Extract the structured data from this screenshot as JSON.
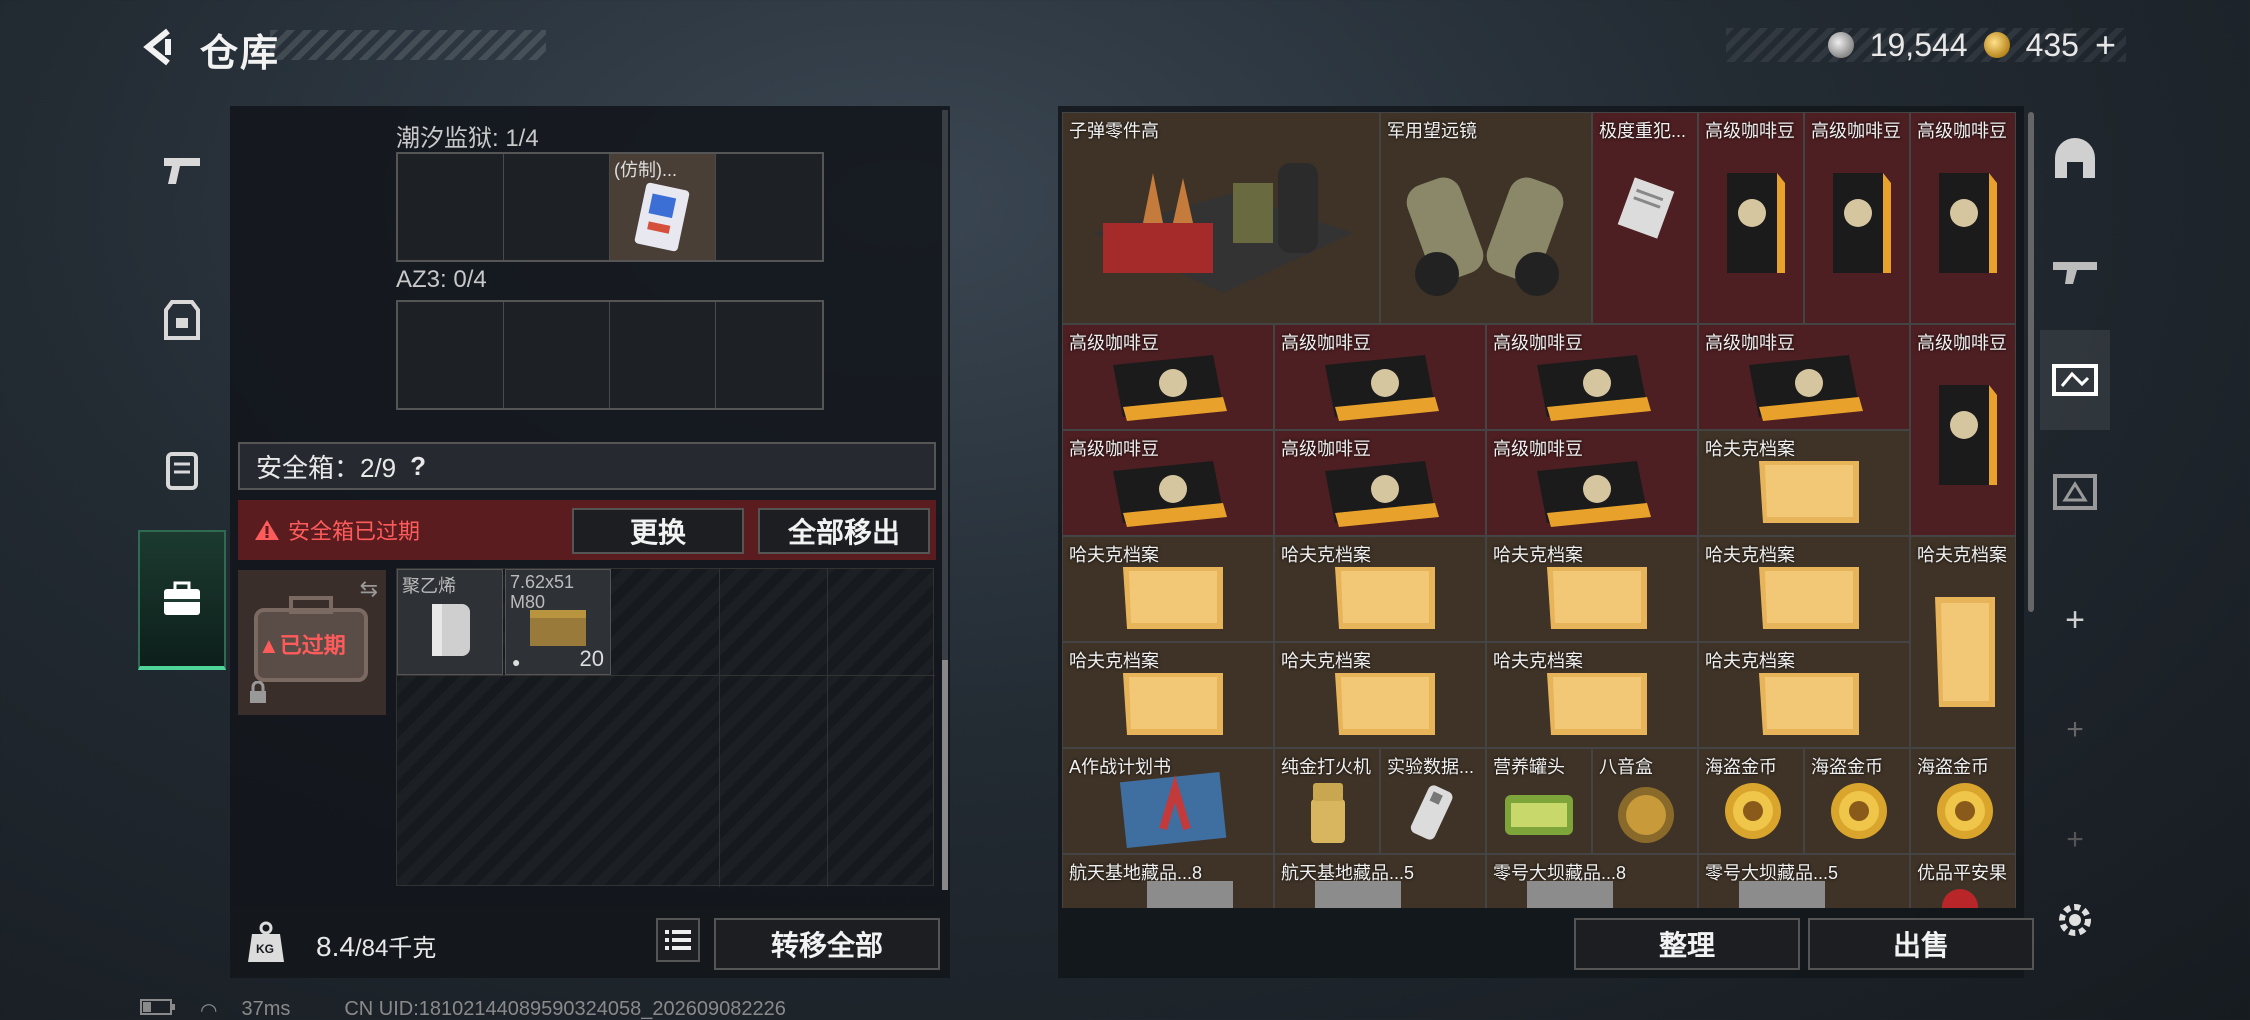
{
  "header": {
    "title": "仓库"
  },
  "currency": {
    "silver_amount": "19,544",
    "gold_amount": "435",
    "gold_plus": "+"
  },
  "left_nav": {
    "items": [
      {
        "name": "weapon-tab",
        "icon": "pistol-icon"
      },
      {
        "name": "armor-tab",
        "icon": "vest-icon"
      },
      {
        "name": "backpack-tab",
        "icon": "backpack-icon"
      },
      {
        "name": "safebox-tab",
        "icon": "briefcase-icon"
      }
    ]
  },
  "containers": {
    "first": {
      "label": "潮汐监狱: 1/4",
      "item_name": "(仿制)..."
    },
    "second": {
      "label": "AZ3: 0/4"
    }
  },
  "safebox": {
    "title": "安全箱：2/9",
    "help": "?",
    "warning": "安全箱已过期",
    "replace_button": "更换",
    "move_all_out_button": "全部移出",
    "expired_badge": "已过期",
    "items": [
      {
        "name": "聚乙烯"
      },
      {
        "name": "7.62x51 M80",
        "count": "20"
      }
    ]
  },
  "weight": {
    "current": "8.4",
    "max": "/84千克",
    "unit_icon": "KG"
  },
  "transfer_all_button": "转移全部",
  "stash": {
    "items": [
      {
        "label": "子弹零件高",
        "row": 0,
        "col": 0,
        "w": 1,
        "h": 1
      },
      {
        "label": "军用望远镜",
        "row": 0,
        "col": 1,
        "w": 1,
        "h": 1
      },
      {
        "label": "极度重犯...",
        "row": 0,
        "col": 2
      },
      {
        "label": "高级咖啡豆",
        "row": 0,
        "col": 3
      },
      {
        "label": "高级咖啡豆",
        "row": 0,
        "col": 4
      },
      {
        "label": "高级咖啡豆",
        "row": 0,
        "col": 5
      },
      {
        "label": "高级咖啡豆",
        "row": 1,
        "col": 0
      },
      {
        "label": "高级咖啡豆",
        "row": 1,
        "col": 1
      },
      {
        "label": "高级咖啡豆",
        "row": 1,
        "col": 2
      },
      {
        "label": "高级咖啡豆",
        "row": 1,
        "col": 3
      },
      {
        "label": "高级咖啡豆",
        "row": 1,
        "col": 4
      },
      {
        "label": "高级咖啡豆",
        "row": 2,
        "col": 0
      },
      {
        "label": "高级咖啡豆",
        "row": 2,
        "col": 1
      },
      {
        "label": "高级咖啡豆",
        "row": 2,
        "col": 2
      },
      {
        "label": "哈夫克档案",
        "row": 2,
        "col": 3
      },
      {
        "label": "哈夫克档案",
        "row": 3,
        "col": 0
      },
      {
        "label": "哈夫克档案",
        "row": 3,
        "col": 1
      },
      {
        "label": "哈夫克档案",
        "row": 3,
        "col": 2
      },
      {
        "label": "哈夫克档案",
        "row": 3,
        "col": 3
      },
      {
        "label": "哈夫克档案",
        "row": 3,
        "col": 4
      },
      {
        "label": "哈夫克档案",
        "row": 4,
        "col": 0
      },
      {
        "label": "哈夫克档案",
        "row": 4,
        "col": 1
      },
      {
        "label": "哈夫克档案",
        "row": 4,
        "col": 2
      },
      {
        "label": "哈夫克档案",
        "row": 4,
        "col": 3
      },
      {
        "label": "A作战计划书",
        "row": 5,
        "col": 0
      },
      {
        "label": "纯金打火机",
        "row": 5,
        "col": 1
      },
      {
        "label": "实验数据...",
        "row": 5,
        "col": 2
      },
      {
        "label": "营养罐头",
        "row": 5,
        "col": 3
      },
      {
        "label": "八音盒",
        "row": 5,
        "col": 4
      },
      {
        "label": "海盗金币",
        "row": 5,
        "col": 5
      },
      {
        "label": "海盗金币",
        "row": 5,
        "col": 6
      },
      {
        "label": "海盗金币",
        "row": 5,
        "col": 7
      },
      {
        "label": "航天基地藏品...8",
        "row": 6,
        "col": 0
      },
      {
        "label": "航天基地藏品...5",
        "row": 6,
        "col": 1
      },
      {
        "label": "零号大坝藏品...8",
        "row": 6,
        "col": 2
      },
      {
        "label": "零号大坝藏品...5",
        "row": 6,
        "col": 3
      },
      {
        "label": "优品平安果",
        "row": 6,
        "col": 4
      }
    ]
  },
  "actions": {
    "organize_button": "整理",
    "sell_button": "出售"
  },
  "status": {
    "ping": "37ms",
    "uid": "CN UID:18102144089590324058_202609082226"
  }
}
